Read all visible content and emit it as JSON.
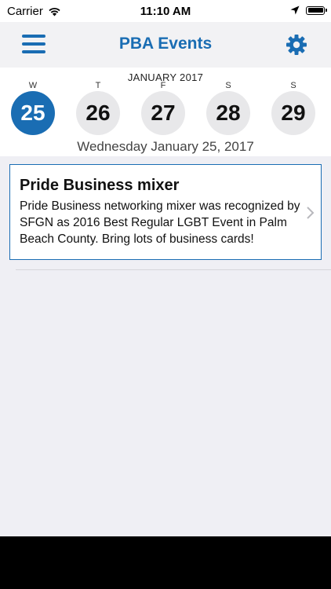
{
  "status_bar": {
    "carrier": "Carrier",
    "time": "11:10 AM",
    "icons": [
      "wifi-icon",
      "location-arrow-icon",
      "battery-icon"
    ]
  },
  "nav": {
    "title": "PBA Events",
    "left_icon": "hamburger-menu-icon",
    "right_icon": "gear-icon",
    "accent_color": "#1a6db3"
  },
  "calendar": {
    "month": "JANUARY 2017",
    "days": [
      {
        "letter": "W",
        "number": "25",
        "selected": true
      },
      {
        "letter": "T",
        "number": "26",
        "selected": false
      },
      {
        "letter": "F",
        "number": "27",
        "selected": false
      },
      {
        "letter": "S",
        "number": "28",
        "selected": false
      },
      {
        "letter": "S",
        "number": "29",
        "selected": false
      }
    ],
    "selected_date": "Wednesday January 25, 2017"
  },
  "events": [
    {
      "title": "Pride Business mixer",
      "description": "Pride Business networking mixer was recognized by SFGN as 2016 Best Regular LGBT Event in Palm Beach County. Bring lots of business cards!"
    }
  ]
}
